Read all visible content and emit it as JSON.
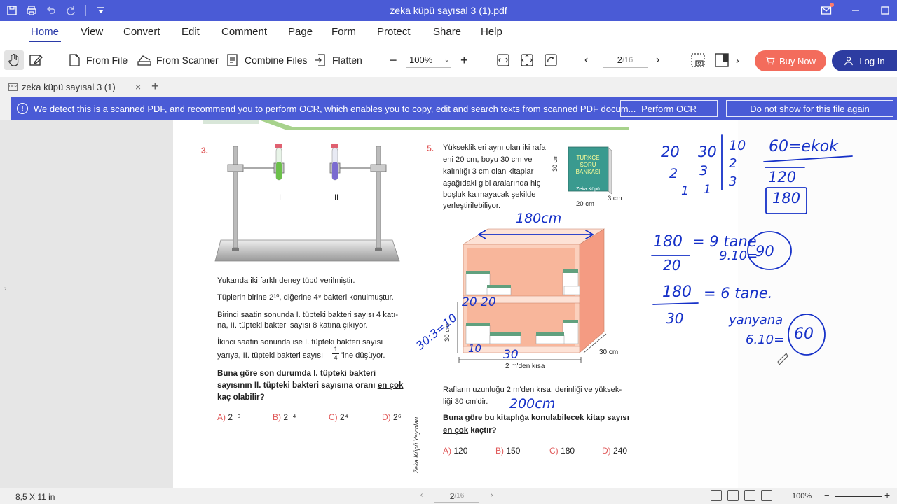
{
  "window": {
    "title": "zeka küpü sayısal 3 (1).pdf"
  },
  "menu": {
    "items": [
      "Home",
      "View",
      "Convert",
      "Edit",
      "Comment",
      "Page",
      "Form",
      "Protect",
      "Share",
      "Help"
    ],
    "active": "Home"
  },
  "toolbar": {
    "from_file": "From File",
    "from_scanner": "From Scanner",
    "combine_files": "Combine Files",
    "flatten": "Flatten",
    "zoom": "100%",
    "page_current": "2",
    "page_total": "/16",
    "buy_now": "Buy Now",
    "log_in": "Log In"
  },
  "tabs": [
    {
      "label": "zeka küpü sayısal 3 (1)"
    }
  ],
  "ocr_banner": {
    "message": "We detect this is a scanned PDF, and recommend you to perform OCR, which enables you to copy, edit and search texts from scanned PDF docum...",
    "perform_ocr": "Perform OCR",
    "dismiss": "Do not show for this file again"
  },
  "document": {
    "q3": {
      "number": "3.",
      "tube_labels": [
        "I",
        "II"
      ],
      "line1": "Yukarıda iki farklı deney tüpü verilmiştir.",
      "line2": "Tüplerin birine 2¹⁰, diğerine 4⁸ bakteri konulmuştur.",
      "line3a": "Birinci saatin sonunda I. tüpteki bakteri sayısı 4 katı-",
      "line3b": "na, II. tüpteki bakteri sayısı 8 katına çıkıyor.",
      "line4a": "İkinci saatin sonunda ise I. tüpteki bakteri sayısı",
      "line4b": "yarıya, II. tüpteki bakteri sayısı",
      "line4c": "'ine düşüyor.",
      "frac_num": "1",
      "frac_den": "4",
      "question_a": "Buna göre son durumda I. tüpteki bakteri",
      "question_b": "sayısının II. tüpteki bakteri sayısına oranı",
      "question_b_u": "en çok",
      "question_c": "kaç olabilir?",
      "options": [
        {
          "letter": "A)",
          "value": "2⁻⁶"
        },
        {
          "letter": "B)",
          "value": "2⁻⁴"
        },
        {
          "letter": "C)",
          "value": "2⁴"
        },
        {
          "letter": "D)",
          "value": "2⁶"
        }
      ]
    },
    "q5": {
      "number": "5.",
      "intro": [
        "Yükseklikleri aynı olan iki rafa",
        "eni 20 cm, boyu 30 cm ve",
        "kalınlığı 3 cm olan kitaplar",
        "aşağıdaki gibi aralarında hiç",
        "boşluk kalmayacak şekilde",
        "yerleştirilebiliyor."
      ],
      "book_title": [
        "TÜRKÇE",
        "SORU",
        "BANKASI"
      ],
      "book_brand": "Zeka Küpü",
      "book_dims": {
        "height": "30 cm",
        "width": "20 cm",
        "depth": "3 cm"
      },
      "shelf_dims": {
        "height": "30 cm",
        "length": "2 m'den kısa",
        "depth": "30 cm"
      },
      "desc": [
        "Rafların uzunluğu 2 m'den kısa, derinliği ve yüksek-",
        "liği 30 cm'dir."
      ],
      "question": "Buna göre bu kitaplığa konulabilecek kitap sayısı",
      "question_u": "en çok",
      "question_end": "kaçtır?",
      "options": [
        {
          "letter": "A)",
          "value": "120"
        },
        {
          "letter": "B)",
          "value": "150"
        },
        {
          "letter": "C)",
          "value": "180"
        },
        {
          "letter": "D)",
          "value": "240"
        }
      ]
    },
    "publisher": "Zeka Küpü Yayınları",
    "handwriting": {
      "h180": "180cm",
      "h200": "200cm",
      "h2020": "20 20",
      "h30_3": "30:3=10",
      "h10a": "10",
      "h30b": "30",
      "grid": [
        "20",
        "30",
        "10",
        "2",
        "3",
        "2",
        "1",
        "1",
        "3"
      ],
      "ekok": "60=ekok",
      "n120": "120",
      "n180": "180",
      "frac1_top": "180",
      "frac1_bot": "20",
      "frac1_res": "= 9 tane",
      "frac1_calc": "9.10=",
      "frac1_circle": "90",
      "frac2_top": "180",
      "frac2_bot": "30",
      "frac2_res": "= 6 tane.",
      "yanyana": "yanyana",
      "calc2": "6.10=",
      "circle2": "60"
    }
  },
  "status": {
    "page_size": "8,5 X 11 in",
    "page_current": "2",
    "page_total": "/16",
    "zoom": "100%"
  }
}
